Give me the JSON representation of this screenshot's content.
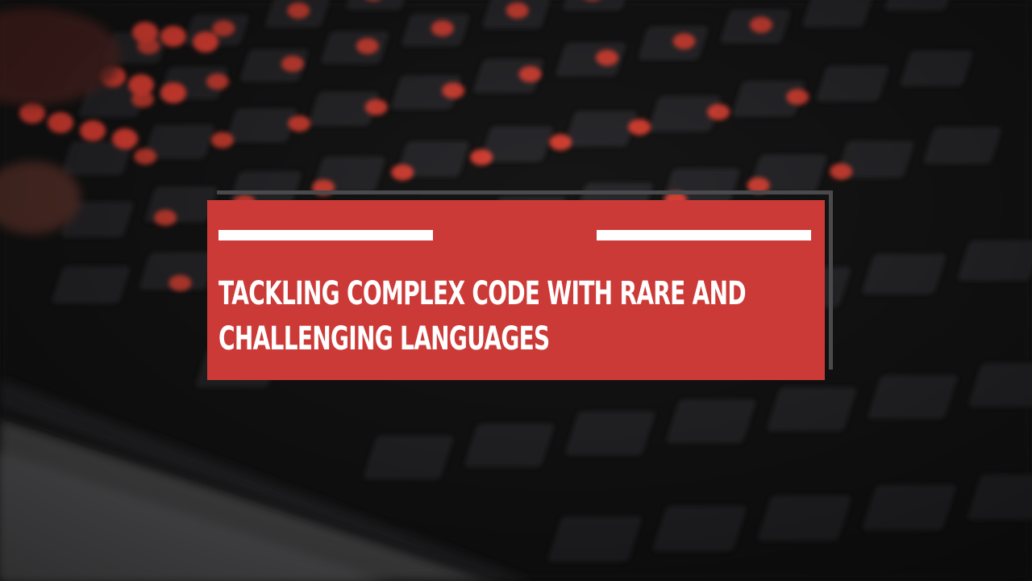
{
  "headline": "TACKLING COMPLEX CODE WITH RARE AND CHALLENGING LANGUAGES",
  "colors": {
    "accent_red": "#cb3a37",
    "shadow_gray": "#4a4a4c",
    "text": "#ffffff",
    "key_glow": "#ff4a3a"
  },
  "background": {
    "subject": "blurred-backlit-keyboard"
  }
}
